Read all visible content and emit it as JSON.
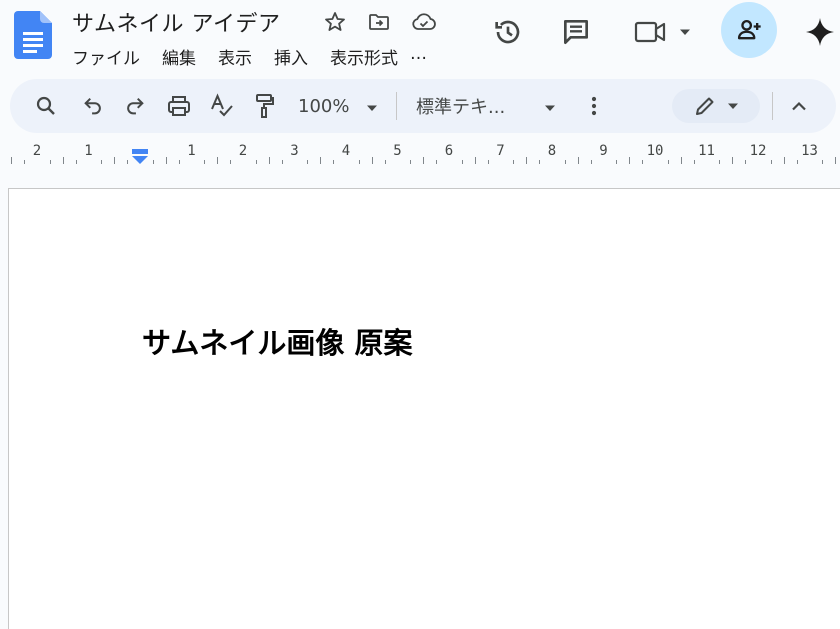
{
  "doc": {
    "title": "サムネイル アイデア",
    "heading": "サムネイル画像 原案"
  },
  "menu": {
    "items": [
      {
        "label": "ファイル"
      },
      {
        "label": "編集"
      },
      {
        "label": "表示"
      },
      {
        "label": "挿入"
      },
      {
        "label": "表示形式"
      },
      {
        "label": "…"
      }
    ]
  },
  "toolbar": {
    "zoom": "100%",
    "style": "標準テキ..."
  },
  "ruler": {
    "labels": [
      "2",
      "1",
      "1",
      "2",
      "3",
      "4",
      "5",
      "6",
      "7",
      "8",
      "9",
      "10",
      "11",
      "12",
      "13"
    ]
  },
  "icons": {
    "logo": "google-docs-logo",
    "star": "star-icon",
    "move": "move-to-folder-icon",
    "cloud": "cloud-saved-icon",
    "history": "history-icon",
    "comment": "comment-icon",
    "meet": "video-camera-icon",
    "share": "add-person-icon",
    "gemini": "gemini-sparkle-icon",
    "search": "search-icon",
    "undo": "undo-icon",
    "redo": "redo-icon",
    "print": "print-icon",
    "spellcheck": "spellcheck-icon",
    "paint": "paint-format-icon",
    "more": "more-vertical-icon",
    "edit": "pencil-icon",
    "collapse": "chevron-up-icon"
  },
  "colors": {
    "background": "#f9fbfd",
    "toolbar": "#edf2fa",
    "share_button": "#c2e7ff",
    "logo_blue": "#4285f4",
    "indent_marker": "#4285f4"
  }
}
